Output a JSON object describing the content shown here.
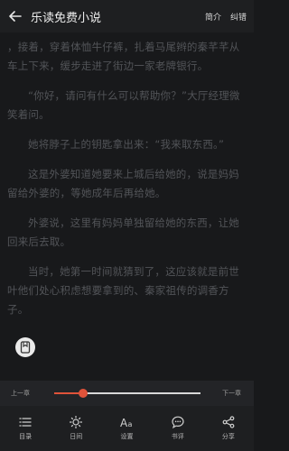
{
  "header": {
    "title": "乐读免费小说",
    "intro_label": "简介",
    "report_label": "纠错"
  },
  "content": {
    "paragraphs": [
      "，接着，穿着体恤牛仔裤，扎着马尾辫的秦芊芊从车上下来，缓步走进了街边一家老牌银行。",
      "“你好，请问有什么可以帮助你？”大厅经理微笑着问。",
      "她将脖子上的钥匙拿出来：“我来取东西。”",
      "这是外婆知道她要来上城后给她的，说是妈妈留给外婆的，等她成年后再给她。",
      "外婆说，这里有妈妈单独留给她的东西，让她回来后去取。",
      "当时，她第一时间就猜到了，这应该就是前世叶他们处心积虑想要拿到的、秦家祖传的调香方子。"
    ]
  },
  "progress": {
    "prev_label": "上一章",
    "next_label": "下一章",
    "value": 0.2,
    "accent_color": "#e0533a"
  },
  "tabs": [
    {
      "label": "目录",
      "icon": "list-icon"
    },
    {
      "label": "日间",
      "icon": "sun-icon"
    },
    {
      "label": "设置",
      "icon": "font-icon"
    },
    {
      "label": "书评",
      "icon": "comment-icon"
    },
    {
      "label": "分享",
      "icon": "share-icon"
    }
  ]
}
